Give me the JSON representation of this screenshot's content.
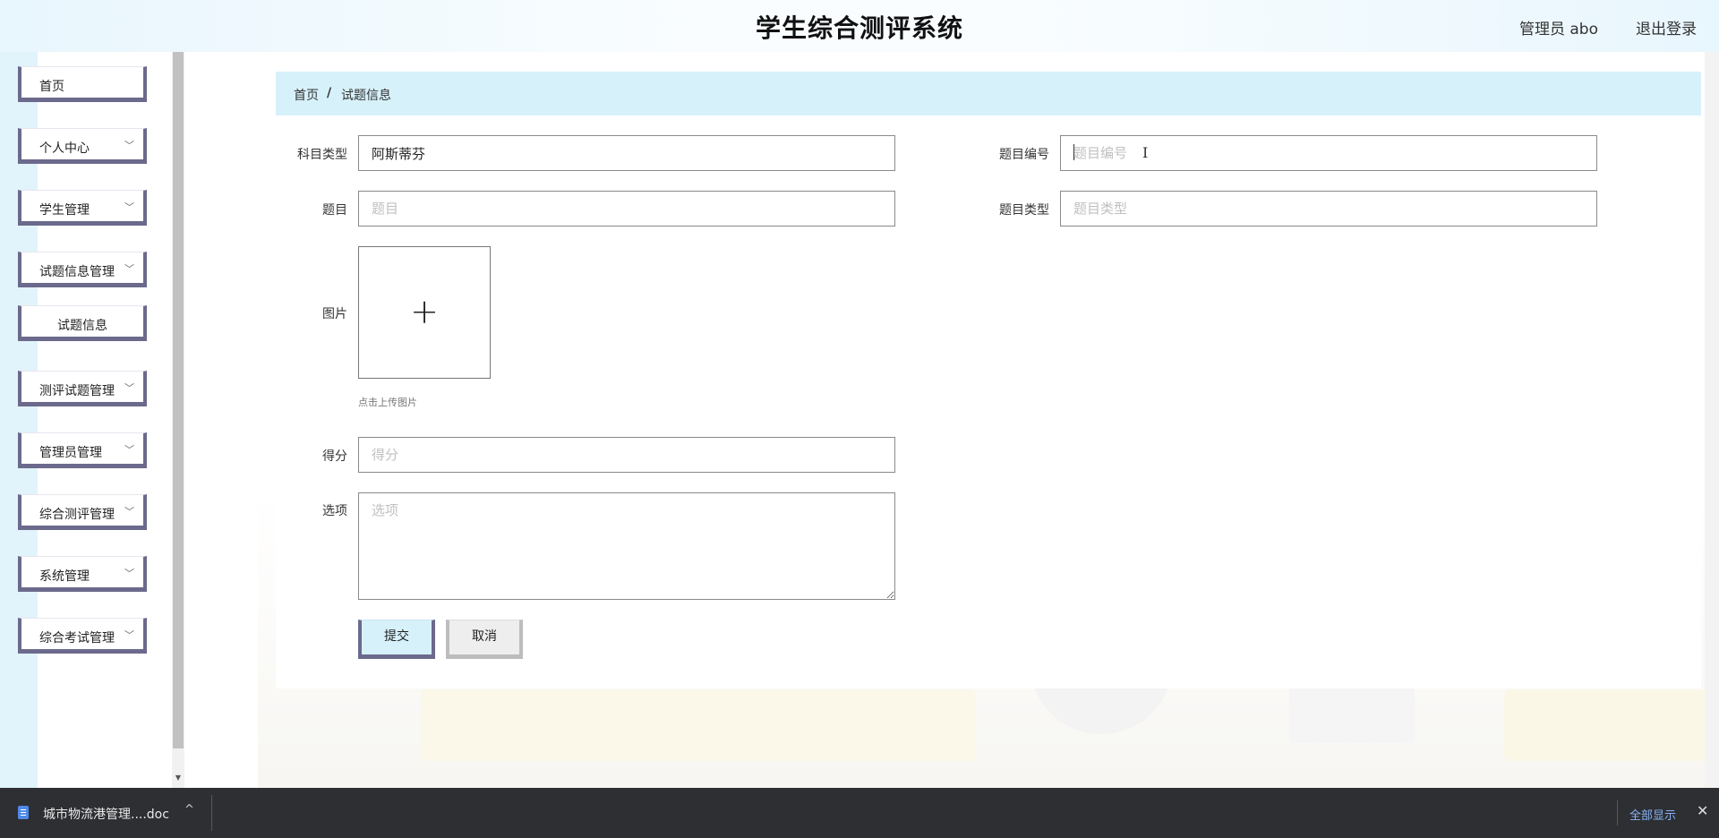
{
  "header": {
    "title": "学生综合测评系统",
    "user": "管理员 abo",
    "logout": "退出登录"
  },
  "sidebar": {
    "items": [
      {
        "label": "首页"
      },
      {
        "label": "个人中心"
      },
      {
        "label": "学生管理"
      },
      {
        "label": "试题信息管理"
      },
      {
        "label": "试题信息"
      },
      {
        "label": "测评试题管理"
      },
      {
        "label": "管理员管理"
      },
      {
        "label": "综合测评管理"
      },
      {
        "label": "系统管理"
      },
      {
        "label": "综合考试管理"
      }
    ]
  },
  "breadcrumb": {
    "home": "首页",
    "separator": "/",
    "current": "试题信息"
  },
  "form": {
    "subject_type": {
      "label": "科目类型",
      "value": "阿斯蒂芬"
    },
    "question_no": {
      "label": "题目编号",
      "placeholder": "题目编号"
    },
    "question": {
      "label": "题目",
      "placeholder": "题目"
    },
    "question_type": {
      "label": "题目类型",
      "placeholder": "题目类型"
    },
    "image": {
      "label": "图片",
      "hint": "点击上传图片",
      "icon": "plus-icon"
    },
    "score": {
      "label": "得分",
      "placeholder": "得分"
    },
    "options": {
      "label": "选项",
      "placeholder": "选项"
    },
    "submit": "提交",
    "cancel": "取消"
  },
  "download_bar": {
    "file_name": "城市物流港管理....doc",
    "show_all": "全部显示",
    "close": "✕",
    "expand": "^"
  },
  "colors": {
    "accent_light_blue": "#d7f1fb",
    "menu_border": "#6b6a8c",
    "download_bar_bg": "#2d2f33",
    "link_blue": "#8ab4f8"
  }
}
